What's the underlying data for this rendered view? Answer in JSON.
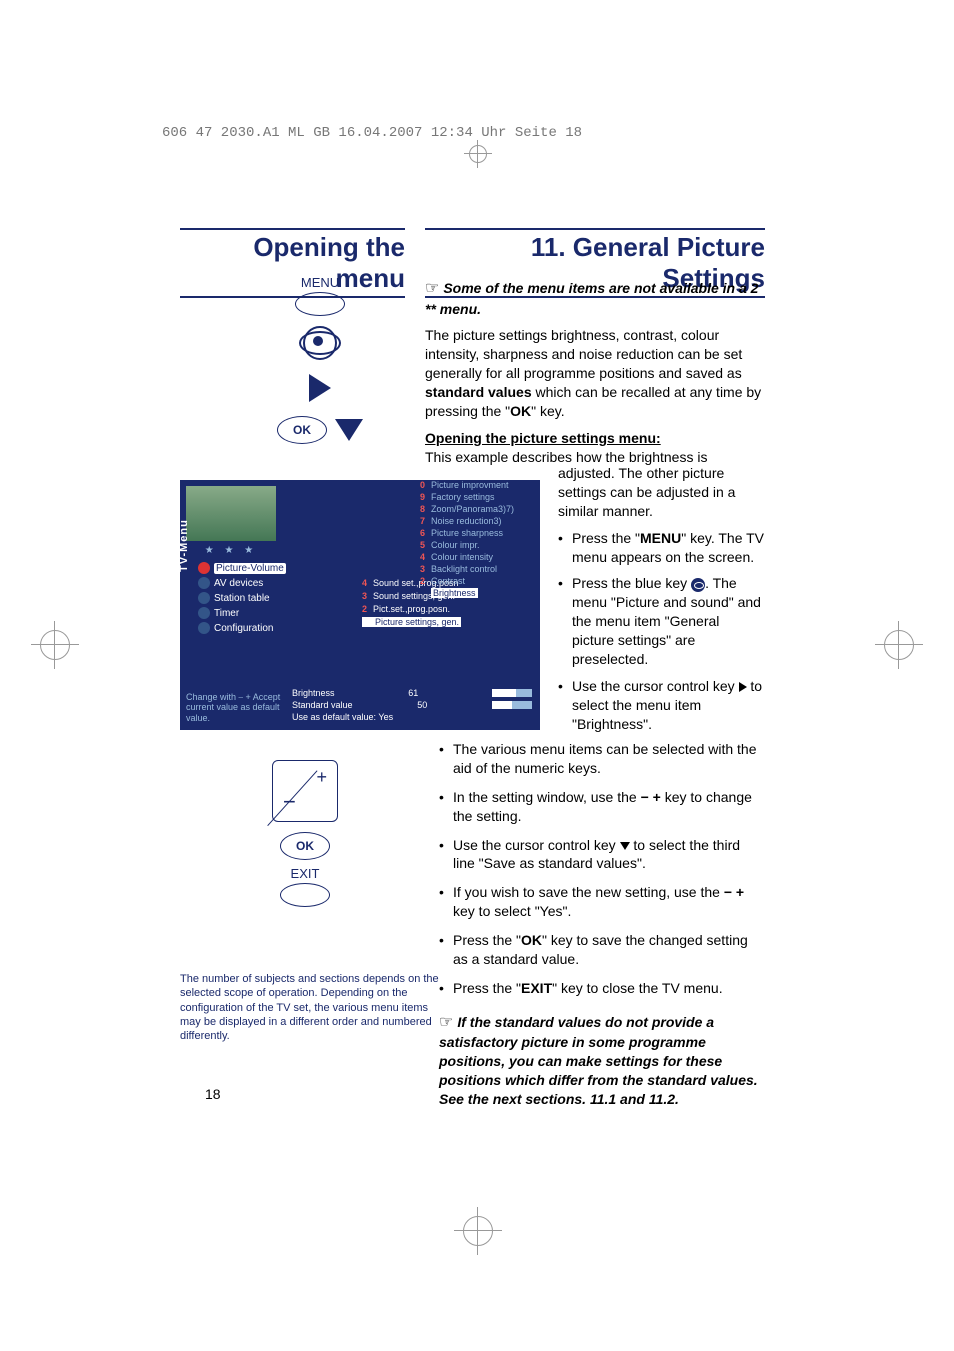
{
  "doc_header": "606 47 2030.A1  ML GB  16.04.2007  12:34 Uhr  Seite 18",
  "page_number": "18",
  "left_title": "Opening the menu",
  "right_title": "11. General Picture Settings",
  "remote": {
    "menu_label": "MENU",
    "ok_label": "OK",
    "exit_label": "EXIT"
  },
  "tv_menu": {
    "side_label": "TV-Menu",
    "stars": "★ ★ ★",
    "rows": [
      {
        "label": "Picture-Volume",
        "sel": true
      },
      {
        "label": "AV devices"
      },
      {
        "label": "Station table"
      },
      {
        "label": "Timer"
      },
      {
        "label": "Configuration"
      }
    ],
    "mid": [
      {
        "num": "4",
        "label": "Sound set.,prog.posn"
      },
      {
        "num": "3",
        "label": "Sound settings, gen."
      },
      {
        "num": "2",
        "label": "Pict.set.,prog.posn."
      },
      {
        "num": "",
        "label": "Picture settings, gen.",
        "sel": true
      }
    ],
    "right": [
      {
        "num": "0",
        "label": "Picture improvment"
      },
      {
        "num": "9",
        "label": "Factory settings"
      },
      {
        "num": "8",
        "label": "Zoom/Panorama3)7)"
      },
      {
        "num": "7",
        "label": "Noise reduction3)"
      },
      {
        "num": "6",
        "label": "Picture sharpness"
      },
      {
        "num": "5",
        "label": "Colour impr."
      },
      {
        "num": "4",
        "label": "Colour intensity"
      },
      {
        "num": "3",
        "label": "Backlight control"
      },
      {
        "num": "2",
        "label": "Contrast"
      },
      {
        "num": "",
        "label": "Brightness",
        "sel": true
      }
    ],
    "bottom_left": "Change with ⎯ +\nAccept current\nvalue as default\nvalue.",
    "bottom_panel": {
      "row1_l": "Brightness",
      "row1_v": "61",
      "row2_l": "Standard value",
      "row2_v": "50",
      "row3": "Use as default value:  Yes"
    }
  },
  "foot_note": "The number of subjects and sections depends on the selected scope of operation. Depending on the configuration of the TV set, the various menu items may be displayed in a different order and numbered differently.",
  "body": {
    "note_top": "Some of the menu items are not available in a 2 ** menu.",
    "para1_a": "The picture settings brightness, contrast, colour intensity, sharpness and noise reduction can be set generally for all programme positions and saved as ",
    "para1_b": "standard values",
    "para1_c": " which can be recalled at any time by pressing the \"",
    "para1_d": "OK",
    "para1_e": "\" key.",
    "sub_h": "Opening the picture settings menu:",
    "para2": "This example describes how the brightness is",
    "narrow": {
      "intro": "adjusted. The other picture settings can be adjusted in a similar manner.",
      "b1a": "Press the \"",
      "b1b": "MENU",
      "b1c": "\" key. The TV menu appears on the screen.",
      "b2": "Press the blue key   . The menu \"Picture and sound\" and the menu item \"General picture settings\" are preselected.",
      "b3a": "Use the cursor control key ",
      "b3b": " to select the menu item \"Brightness\"."
    },
    "wide": {
      "b1": "The various menu items can be selected with the aid of the numeric keys.",
      "b2a": "In the setting window, use the ",
      "b2b": " key to change the setting.",
      "b3a": "Use the cursor control key ",
      "b3b": " to select the third line \"Save as standard values\".",
      "b4a": "If you wish to save the new setting, use the ",
      "b4b": " key to select \"Yes\".",
      "b5a": "Press the \"",
      "b5b": "OK",
      "b5c": "\" key to save the changed setting as a standard value.",
      "b6a": "Press the \"",
      "b6b": "EXIT",
      "b6c": "\" key to close the TV menu.",
      "note_bottom": "If the standard values do not provide a satisfactory picture in some programme positions, you can make settings for these positions which differ from the standard values. See the next sections. 11.1 and 11.2."
    }
  }
}
